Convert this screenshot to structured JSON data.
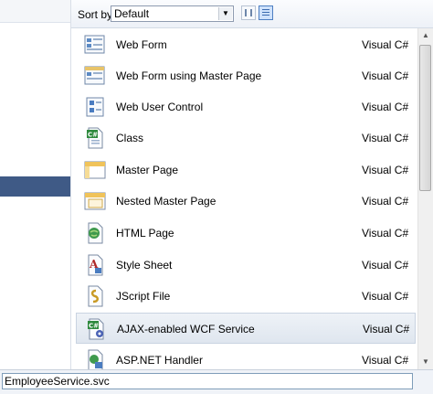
{
  "toolbar": {
    "sort_label": "Sort by:",
    "sort_value": "Default",
    "view_small_icons": "small-icons-view-icon",
    "view_list": "list-view-icon"
  },
  "templates": [
    {
      "name": "Web Form",
      "lang": "Visual C#",
      "icon": "web-form-icon"
    },
    {
      "name": "Web Form using Master Page",
      "lang": "Visual C#",
      "icon": "web-form-master-icon"
    },
    {
      "name": "Web User Control",
      "lang": "Visual C#",
      "icon": "user-control-icon"
    },
    {
      "name": "Class",
      "lang": "Visual C#",
      "icon": "class-file-icon"
    },
    {
      "name": "Master Page",
      "lang": "Visual C#",
      "icon": "master-page-icon"
    },
    {
      "name": "Nested Master Page",
      "lang": "Visual C#",
      "icon": "nested-master-page-icon"
    },
    {
      "name": "HTML Page",
      "lang": "Visual C#",
      "icon": "html-page-icon"
    },
    {
      "name": "Style Sheet",
      "lang": "Visual C#",
      "icon": "style-sheet-icon"
    },
    {
      "name": "JScript File",
      "lang": "Visual C#",
      "icon": "jscript-file-icon"
    },
    {
      "name": "AJAX-enabled WCF Service",
      "lang": "Visual C#",
      "icon": "wcf-service-icon"
    },
    {
      "name": "ASP.NET Handler",
      "lang": "Visual C#",
      "icon": "handler-icon"
    }
  ],
  "selected_index": 9,
  "name_field": {
    "value": "EmployeeService.svc"
  },
  "colors": {
    "selection_band": "#3f5a86",
    "row_selected": "#dfe6ef"
  }
}
